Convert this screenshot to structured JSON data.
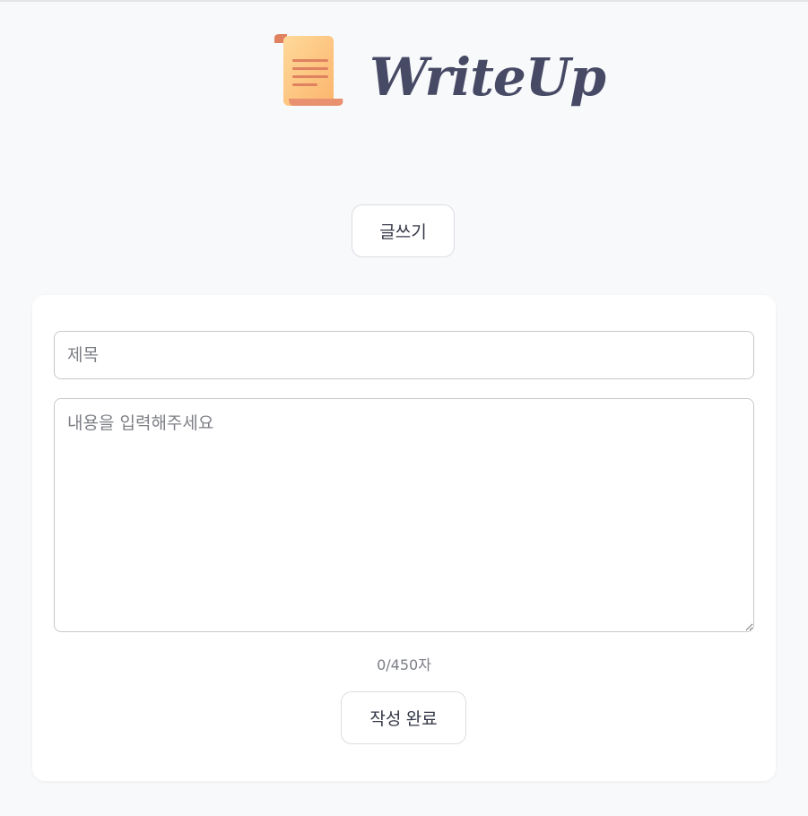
{
  "brand": {
    "name": "WriteUp",
    "icon": "scroll-icon",
    "text_color": "#474a64"
  },
  "header": {
    "write_button_label": "글쓰기"
  },
  "form": {
    "title_placeholder": "제목",
    "title_value": "",
    "content_placeholder": "내용을 입력해주세요",
    "content_value": "",
    "char_count": "0/450자",
    "submit_label": "작성 완료"
  },
  "colors": {
    "background": "#f8f9fb",
    "card": "#ffffff",
    "text": "#343747",
    "muted": "#7b7e85"
  }
}
